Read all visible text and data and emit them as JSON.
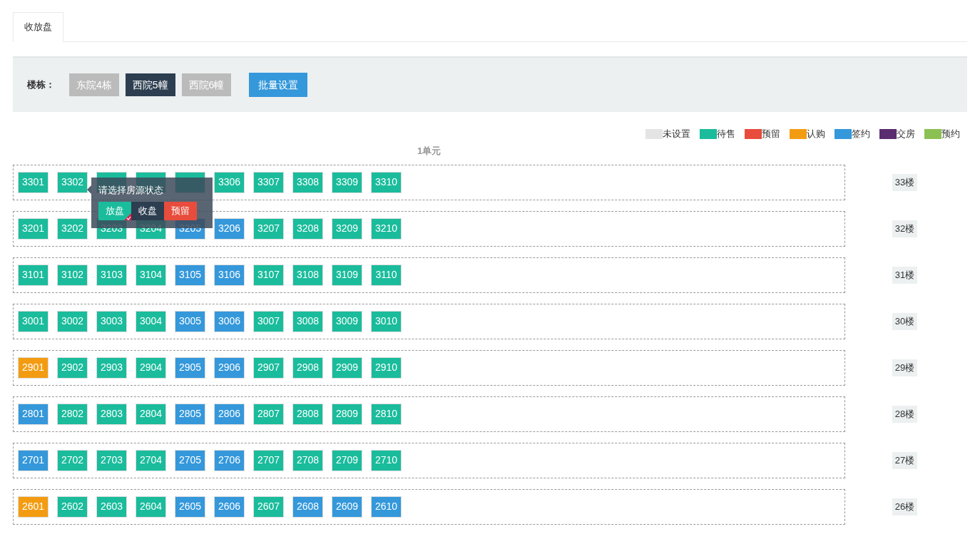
{
  "tabs": [
    {
      "label": "收放盘",
      "selected": true
    }
  ],
  "toolbar": {
    "label": "楼栋：",
    "buildings": [
      {
        "label": "东院4栋",
        "selected": false
      },
      {
        "label": "西院5幢",
        "selected": true
      },
      {
        "label": "西院6幢",
        "selected": false
      }
    ],
    "batch_button": "批量设置"
  },
  "legend": [
    {
      "label": "未设置",
      "color": "#e4e4e4"
    },
    {
      "label": "待售",
      "color": "#1abc9c"
    },
    {
      "label": "预留",
      "color": "#e74c3c"
    },
    {
      "label": "认购",
      "color": "#f39c12"
    },
    {
      "label": "签约",
      "color": "#3498db"
    },
    {
      "label": "交房",
      "color": "#5b2c6f"
    },
    {
      "label": "预约",
      "color": "#8bc152"
    }
  ],
  "unit_title": "1单元",
  "popover": {
    "title": "请选择房源状态",
    "options": [
      {
        "label": "放盘",
        "color": "#1abc9c",
        "selected": true
      },
      {
        "label": "收盘",
        "color": "#2c3e50",
        "selected": false
      },
      {
        "label": "预留",
        "color": "#e74c3c",
        "selected": false
      }
    ]
  },
  "floors": [
    {
      "label": "33楼",
      "units": [
        {
          "label": "3301",
          "color": "#1abc9c"
        },
        {
          "label": "3302",
          "color": "#1abc9c"
        },
        {
          "color": "#1abc9c"
        },
        {
          "color": "#1abc9c"
        },
        {
          "color": "#1abc9c"
        },
        {
          "label": "3306",
          "color": "#1abc9c"
        },
        {
          "label": "3307",
          "color": "#1abc9c"
        },
        {
          "label": "3308",
          "color": "#1abc9c"
        },
        {
          "label": "3309",
          "color": "#1abc9c"
        },
        {
          "label": "3310",
          "color": "#1abc9c"
        }
      ]
    },
    {
      "label": "32楼",
      "units": [
        {
          "label": "3201",
          "color": "#1abc9c"
        },
        {
          "label": "3202",
          "color": "#1abc9c"
        },
        {
          "label": "3203",
          "color": "#1abc9c"
        },
        {
          "label": "3204",
          "color": "#1abc9c"
        },
        {
          "label": "3205",
          "color": "#3498db"
        },
        {
          "label": "3206",
          "color": "#3498db"
        },
        {
          "label": "3207",
          "color": "#1abc9c"
        },
        {
          "label": "3208",
          "color": "#1abc9c"
        },
        {
          "label": "3209",
          "color": "#1abc9c"
        },
        {
          "label": "3210",
          "color": "#1abc9c"
        }
      ]
    },
    {
      "label": "31楼",
      "units": [
        {
          "label": "3101",
          "color": "#1abc9c"
        },
        {
          "label": "3102",
          "color": "#1abc9c"
        },
        {
          "label": "3103",
          "color": "#1abc9c"
        },
        {
          "label": "3104",
          "color": "#1abc9c"
        },
        {
          "label": "3105",
          "color": "#3498db"
        },
        {
          "label": "3106",
          "color": "#3498db"
        },
        {
          "label": "3107",
          "color": "#1abc9c"
        },
        {
          "label": "3108",
          "color": "#1abc9c"
        },
        {
          "label": "3109",
          "color": "#1abc9c"
        },
        {
          "label": "3110",
          "color": "#1abc9c"
        }
      ]
    },
    {
      "label": "30楼",
      "units": [
        {
          "label": "3001",
          "color": "#1abc9c"
        },
        {
          "label": "3002",
          "color": "#1abc9c"
        },
        {
          "label": "3003",
          "color": "#1abc9c"
        },
        {
          "label": "3004",
          "color": "#1abc9c"
        },
        {
          "label": "3005",
          "color": "#3498db"
        },
        {
          "label": "3006",
          "color": "#3498db"
        },
        {
          "label": "3007",
          "color": "#1abc9c"
        },
        {
          "label": "3008",
          "color": "#1abc9c"
        },
        {
          "label": "3009",
          "color": "#1abc9c"
        },
        {
          "label": "3010",
          "color": "#1abc9c"
        }
      ]
    },
    {
      "label": "29楼",
      "units": [
        {
          "label": "2901",
          "color": "#f39c12"
        },
        {
          "label": "2902",
          "color": "#1abc9c"
        },
        {
          "label": "2903",
          "color": "#1abc9c"
        },
        {
          "label": "2904",
          "color": "#1abc9c"
        },
        {
          "label": "2905",
          "color": "#3498db"
        },
        {
          "label": "2906",
          "color": "#3498db"
        },
        {
          "label": "2907",
          "color": "#1abc9c"
        },
        {
          "label": "2908",
          "color": "#1abc9c"
        },
        {
          "label": "2909",
          "color": "#1abc9c"
        },
        {
          "label": "2910",
          "color": "#1abc9c"
        }
      ]
    },
    {
      "label": "28楼",
      "units": [
        {
          "label": "2801",
          "color": "#3498db"
        },
        {
          "label": "2802",
          "color": "#1abc9c"
        },
        {
          "label": "2803",
          "color": "#1abc9c"
        },
        {
          "label": "2804",
          "color": "#1abc9c"
        },
        {
          "label": "2805",
          "color": "#3498db"
        },
        {
          "label": "2806",
          "color": "#3498db"
        },
        {
          "label": "2807",
          "color": "#1abc9c"
        },
        {
          "label": "2808",
          "color": "#1abc9c"
        },
        {
          "label": "2809",
          "color": "#1abc9c"
        },
        {
          "label": "2810",
          "color": "#1abc9c"
        }
      ]
    },
    {
      "label": "27楼",
      "units": [
        {
          "label": "2701",
          "color": "#3498db"
        },
        {
          "label": "2702",
          "color": "#1abc9c"
        },
        {
          "label": "2703",
          "color": "#1abc9c"
        },
        {
          "label": "2704",
          "color": "#1abc9c"
        },
        {
          "label": "2705",
          "color": "#3498db"
        },
        {
          "label": "2706",
          "color": "#3498db"
        },
        {
          "label": "2707",
          "color": "#1abc9c"
        },
        {
          "label": "2708",
          "color": "#1abc9c"
        },
        {
          "label": "2709",
          "color": "#1abc9c"
        },
        {
          "label": "2710",
          "color": "#1abc9c"
        }
      ]
    },
    {
      "label": "26楼",
      "units": [
        {
          "label": "2601",
          "color": "#f39c12"
        },
        {
          "label": "2602",
          "color": "#1abc9c"
        },
        {
          "label": "2603",
          "color": "#1abc9c"
        },
        {
          "label": "2604",
          "color": "#1abc9c"
        },
        {
          "label": "2605",
          "color": "#3498db"
        },
        {
          "label": "2606",
          "color": "#3498db"
        },
        {
          "label": "2607",
          "color": "#1abc9c"
        },
        {
          "label": "2608",
          "color": "#3498db"
        },
        {
          "label": "2609",
          "color": "#3498db"
        },
        {
          "label": "2610",
          "color": "#3498db"
        }
      ]
    }
  ]
}
